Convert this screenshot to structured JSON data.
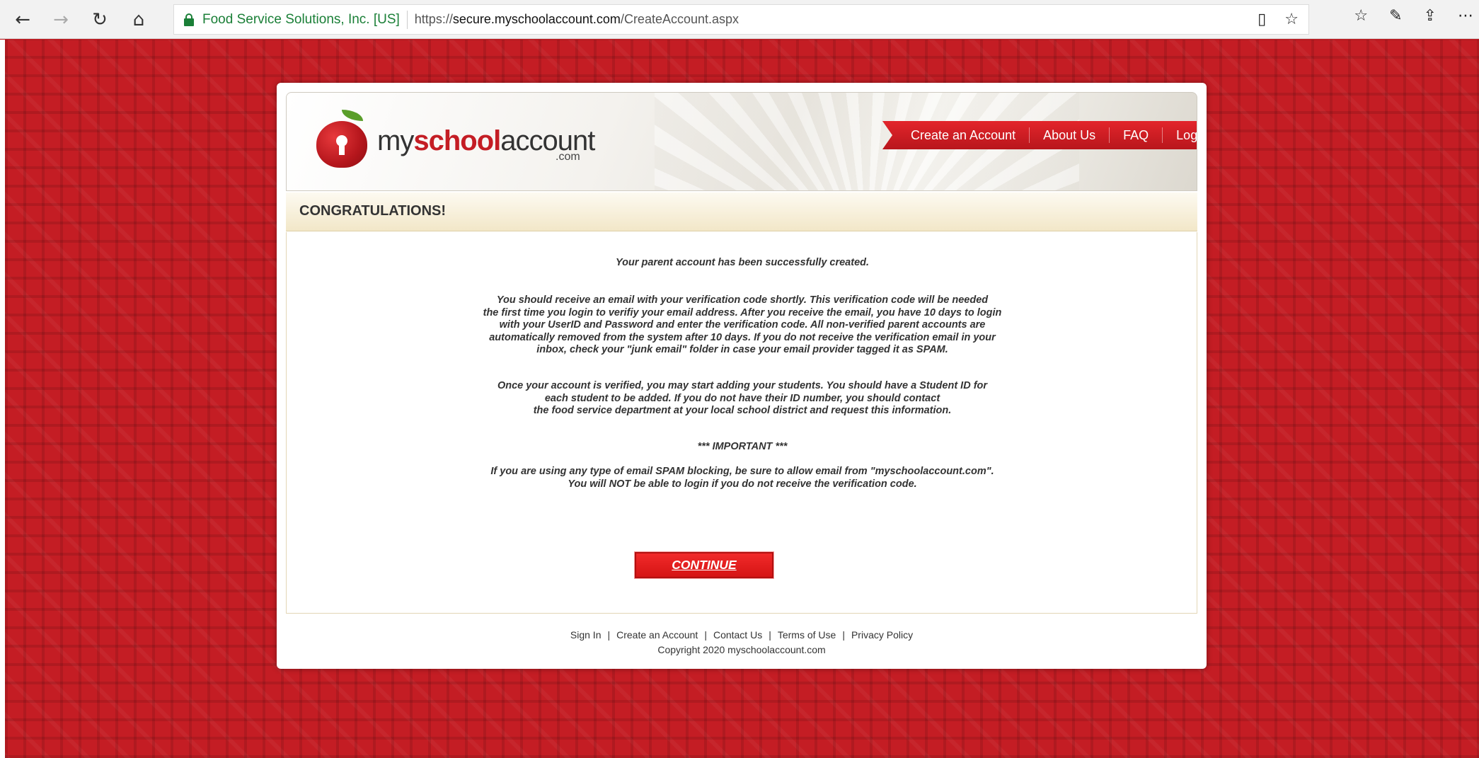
{
  "browser": {
    "cert_label": "Food Service Solutions, Inc. [US]",
    "url_prefix": "https://",
    "url_host": "secure.myschoolaccount.com",
    "url_path": "/CreateAccount.aspx"
  },
  "logo": {
    "part1": "my",
    "part2": "school",
    "part3": "account",
    "suffix": ".com"
  },
  "nav": {
    "items": [
      "Create an Account",
      "About Us",
      "FAQ",
      "Login"
    ]
  },
  "banner": {
    "title": "CONGRATULATIONS!"
  },
  "content": {
    "line1": "Your parent account has been successfully created.",
    "para2": [
      "You should receive an email with your verification code shortly. This verification code will be needed",
      "the first time you login to verifiy your email address.  After you receive the email, you have 10 days to login",
      "with your UserID and Password and enter the verification code. All non-verified parent accounts are",
      "automatically removed from the system after 10 days. If you do not receive the verification email in your",
      "inbox, check your \"junk email\" folder in case your email provider tagged it as SPAM."
    ],
    "para3": [
      "Once your account is verified, you may start adding your students. You should have a Student ID for",
      "each student to be added. If you do not have their ID number, you should contact",
      "the food service department at your local school district and request this information."
    ],
    "important": "*** IMPORTANT ***",
    "para4": [
      "If you are using any type of email SPAM blocking, be sure to allow email from \"myschoolaccount.com\".",
      "You will NOT be able to login if you do not receive the verification code."
    ],
    "continue_label": "CONTINUE"
  },
  "footer": {
    "links": [
      "Sign In",
      "Create an Account",
      "Contact Us",
      "Terms of Use",
      "Privacy Policy"
    ],
    "copyright": "Copyright 2020 myschoolaccount.com"
  }
}
